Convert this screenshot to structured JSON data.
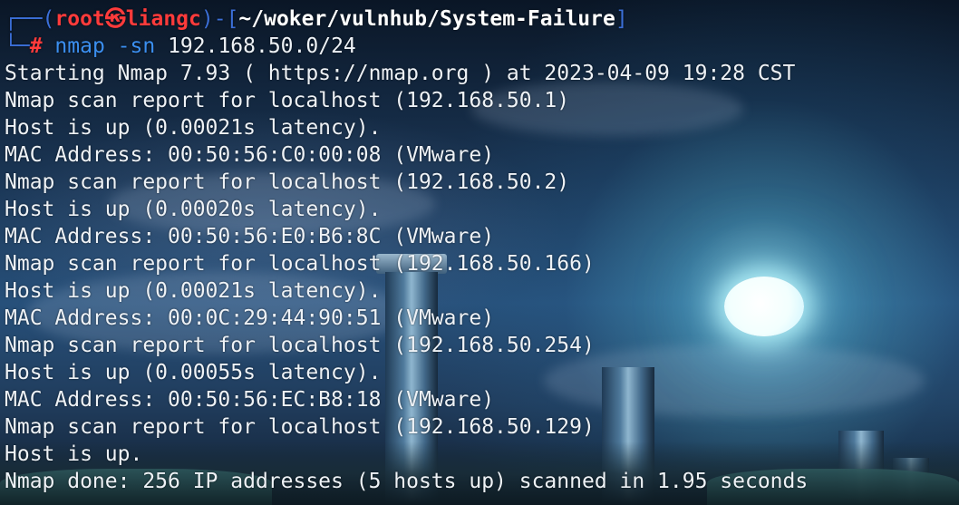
{
  "prompt": {
    "user": "root",
    "host": "liangc",
    "path": "~/woker/vulnhub/System-Failure",
    "command": "nmap",
    "flag": "-sn",
    "target": "192.168.50.0/24"
  },
  "output": [
    "Starting Nmap 7.93 ( https://nmap.org ) at 2023-04-09 19:28 CST",
    "Nmap scan report for localhost (192.168.50.1)",
    "Host is up (0.00021s latency).",
    "MAC Address: 00:50:56:C0:00:08 (VMware)",
    "Nmap scan report for localhost (192.168.50.2)",
    "Host is up (0.00020s latency).",
    "MAC Address: 00:50:56:E0:B6:8C (VMware)",
    "Nmap scan report for localhost (192.168.50.166)",
    "Host is up (0.00021s latency).",
    "MAC Address: 00:0C:29:44:90:51 (VMware)",
    "Nmap scan report for localhost (192.168.50.254)",
    "Host is up (0.00055s latency).",
    "MAC Address: 00:50:56:EC:B8:18 (VMware)",
    "Nmap scan report for localhost (192.168.50.129)",
    "Host is up.",
    "Nmap done: 256 IP addresses (5 hosts up) scanned in 1.95 seconds"
  ],
  "colors": {
    "prompt_frame": "#3b6fd8",
    "user_host": "#ff3b3b",
    "command": "#3b8ff0",
    "text": "#eef2f6"
  }
}
